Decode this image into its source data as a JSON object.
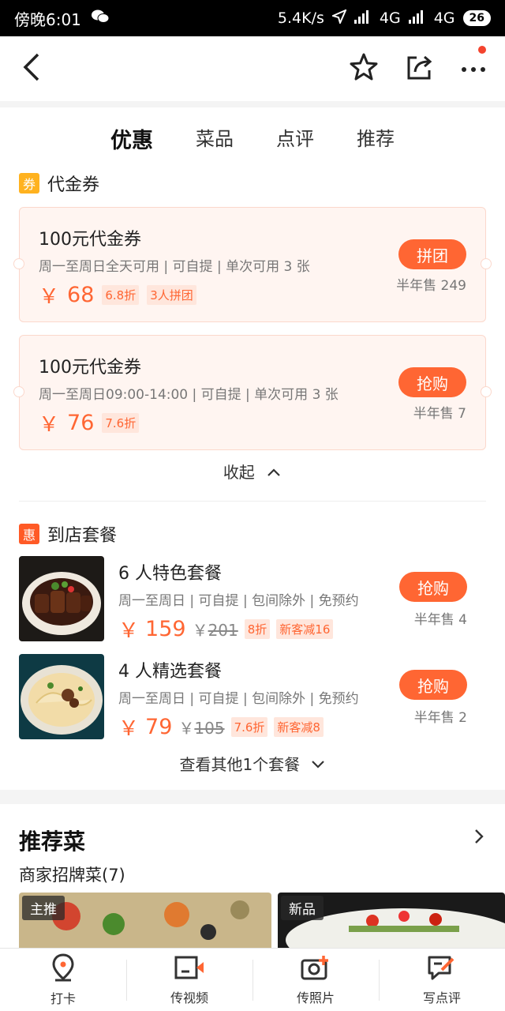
{
  "status_bar": {
    "time": "傍晚6:01",
    "net_speed": "5.4K/s",
    "net1": "4G",
    "net2": "4G",
    "battery": "26"
  },
  "tabs": [
    {
      "label": "优惠",
      "active": true
    },
    {
      "label": "菜品"
    },
    {
      "label": "点评"
    },
    {
      "label": "推荐"
    }
  ],
  "vouchers": {
    "badge": "券",
    "heading": "代金券",
    "items": [
      {
        "title": "100元代金券",
        "desc": "周一至周日全天可用 | 可自提 | 单次可用 3 张",
        "yen": "￥",
        "price": "68",
        "discount": "6.8折",
        "extra_tag": "3人拼团",
        "button": "拼团",
        "sold": "半年售 249"
      },
      {
        "title": "100元代金券",
        "desc": "周一至周日09:00-14:00 | 可自提 | 单次可用 3 张",
        "yen": "￥",
        "price": "76",
        "discount": "7.6折",
        "button": "抢购",
        "sold": "半年售 7"
      }
    ],
    "collapse_label": "收起"
  },
  "packages": {
    "badge": "惠",
    "heading": "到店套餐",
    "items": [
      {
        "name": "6 人特色套餐",
        "desc": "周一至周日 | 可自提 | 包间除外 | 免预约",
        "yen": "￥",
        "price": "159",
        "orig_yen": "￥",
        "orig": "201",
        "discount": "8折",
        "promo": "新客减16",
        "button": "抢购",
        "sold": "半年售 4"
      },
      {
        "name": "4 人精选套餐",
        "desc": "周一至周日 | 可自提 | 包间除外 | 免预约",
        "yen": "￥",
        "price": "79",
        "orig_yen": "￥",
        "orig": "105",
        "discount": "7.6折",
        "promo": "新客减8",
        "button": "抢购",
        "sold": "半年售 2"
      }
    ],
    "more_label": "查看其他1个套餐"
  },
  "recommend": {
    "title": "推荐菜",
    "subtitle": "商家招牌菜(7)",
    "dishes": [
      {
        "label": "主推"
      },
      {
        "label": "新品"
      }
    ]
  },
  "bottom_bar": [
    {
      "label": "打卡",
      "icon": "location-pin-icon"
    },
    {
      "label": "传视频",
      "icon": "video-upload-icon"
    },
    {
      "label": "传照片",
      "icon": "camera-plus-icon"
    },
    {
      "label": "写点评",
      "icon": "edit-review-icon"
    }
  ],
  "colors": {
    "accent": "#ff6633",
    "voucher_badge": "#ffb21f",
    "package_badge": "#ff5a26"
  }
}
